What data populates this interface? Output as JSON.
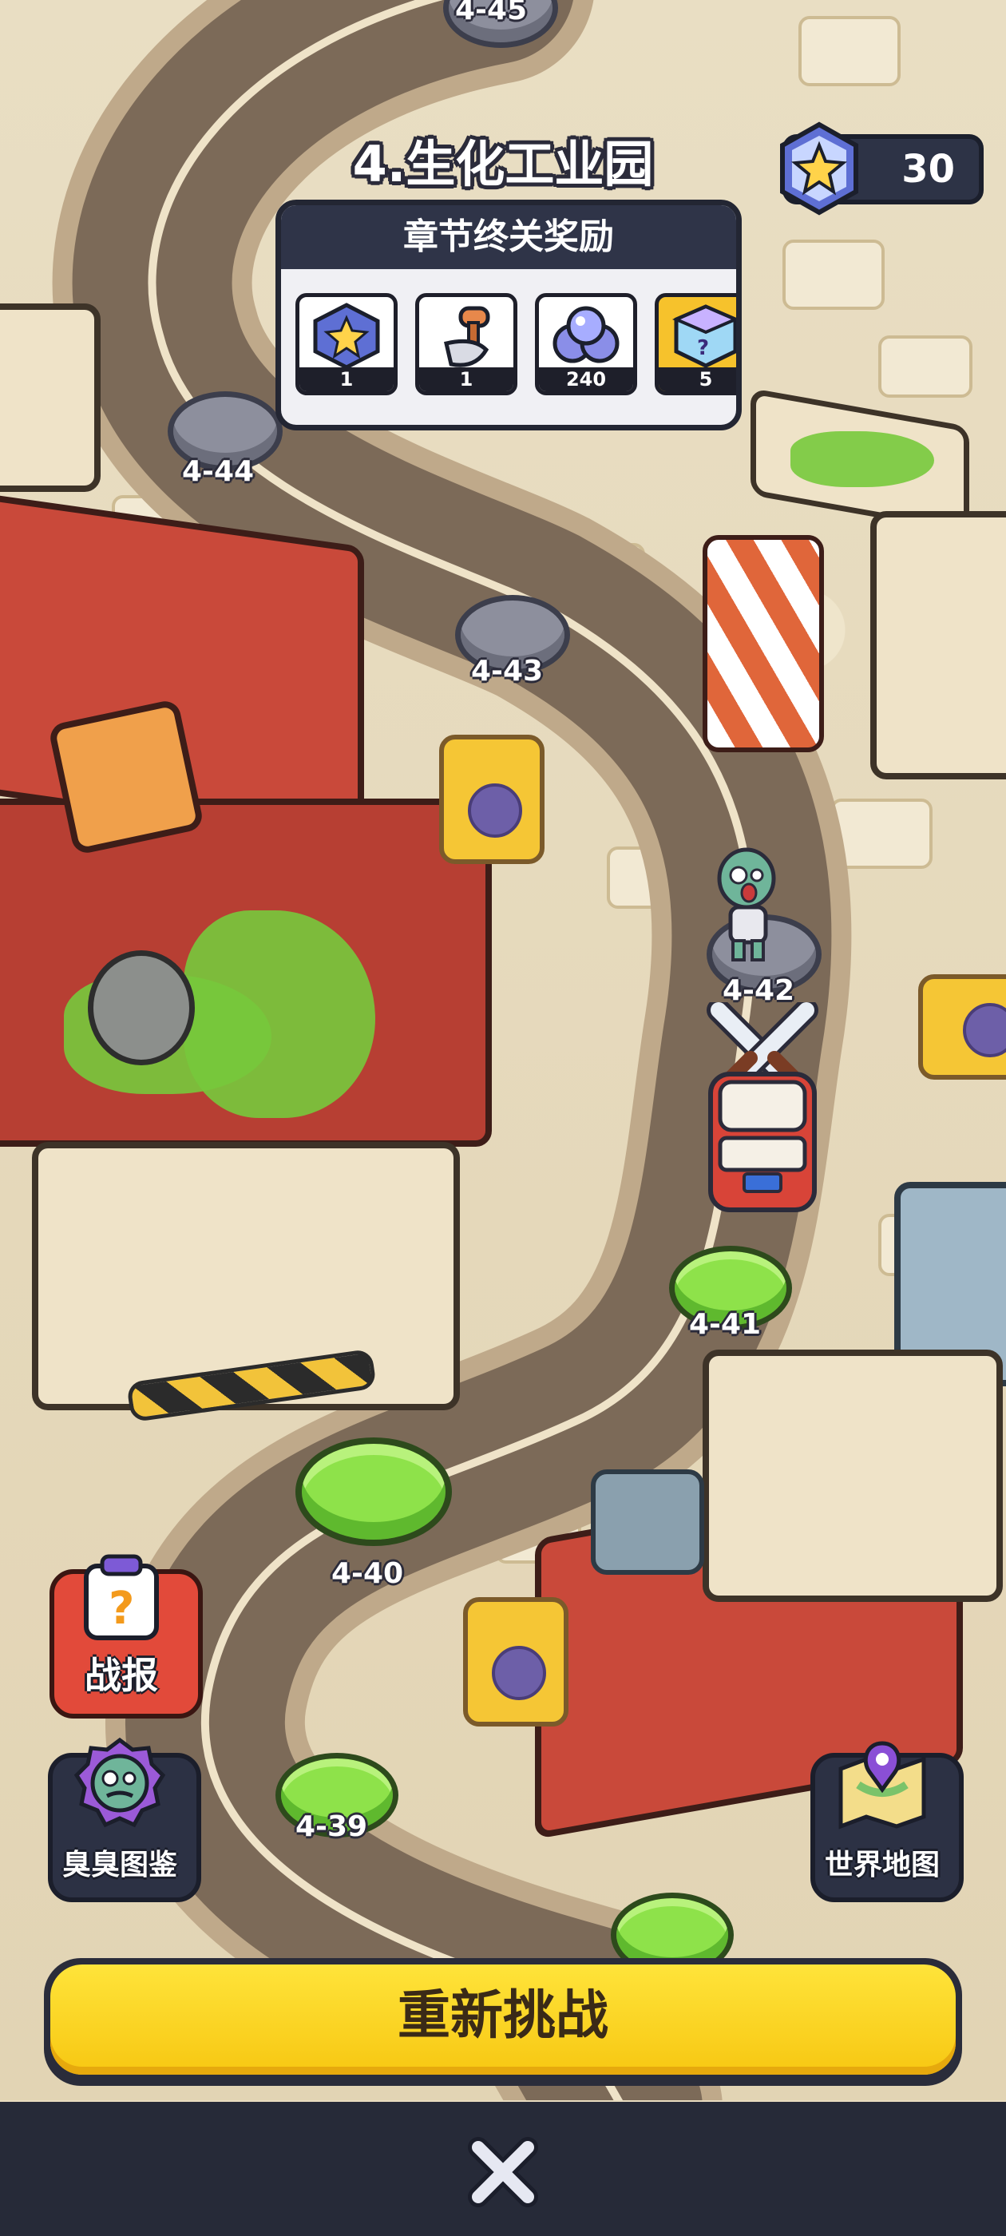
{
  "chapter": {
    "title": "4.生化工业园"
  },
  "stars": {
    "count": "30",
    "icon": "rainbow-star-badge-icon"
  },
  "reward_panel": {
    "header": "章节终关奖励",
    "items": [
      {
        "icon": "star-badge-icon",
        "qty": "1"
      },
      {
        "icon": "shovel-icon",
        "qty": "1"
      },
      {
        "icon": "orbs-icon",
        "qty": "240"
      },
      {
        "icon": "mystery-box-icon",
        "qty": "5"
      }
    ]
  },
  "levels": [
    {
      "id": "4-45",
      "state": "locked"
    },
    {
      "id": "4-44",
      "state": "locked"
    },
    {
      "id": "4-43",
      "state": "locked"
    },
    {
      "id": "4-42",
      "state": "current"
    },
    {
      "id": "4-41",
      "state": "cleared"
    },
    {
      "id": "4-40",
      "state": "cleared"
    },
    {
      "id": "4-39",
      "state": "cleared"
    }
  ],
  "side_buttons": {
    "battle_report": "战报",
    "zombie_guide": "臭臭图鉴",
    "world_map": "世界地图"
  },
  "retry_label": "重新挑战",
  "colors": {
    "accent_yellow": "#f7c712",
    "cleared_green": "#8ee24a",
    "locked_grey": "#8d8f9d",
    "panel_dark": "#2f3448"
  }
}
